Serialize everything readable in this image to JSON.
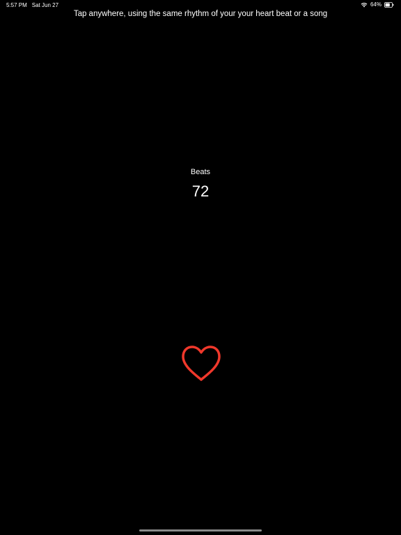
{
  "status_bar": {
    "time": "5:57 PM",
    "date": "Sat Jun 27",
    "battery": "64%",
    "icons": [
      "wifi-icon",
      "battery-icon"
    ]
  },
  "instruction": "Tap anywhere, using the same rhythm of your your heart beat or a song",
  "beats": {
    "label": "Beats",
    "value": "72"
  },
  "heart": {
    "icon": "heart-icon",
    "color": "#f0382b"
  },
  "colors": {
    "background": "#000000",
    "text": "#ffffff"
  }
}
